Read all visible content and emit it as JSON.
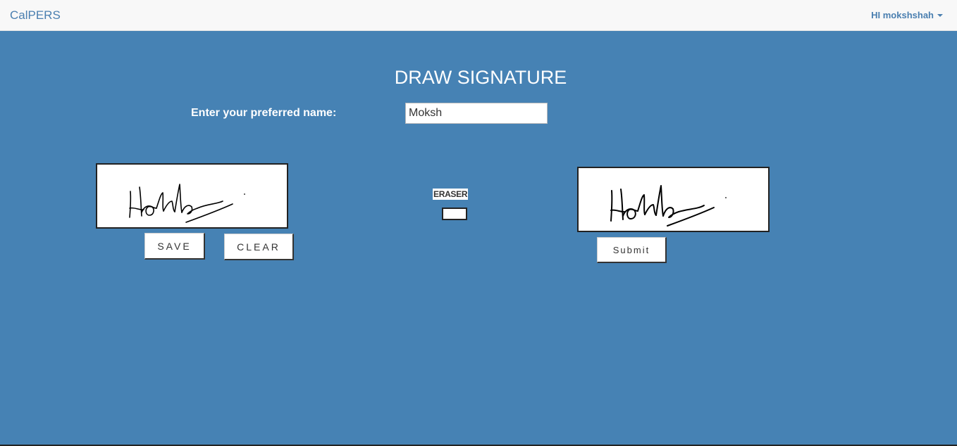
{
  "navbar": {
    "brand": "CalPERS",
    "user_greeting": "HI mokshshah",
    "user_menu_icon": "caret-down-icon"
  },
  "main": {
    "title": "DRAW SIGNATURE",
    "name_label": "Enter your preferred name:",
    "name_value": "Moksh",
    "save_label": "SAVE",
    "clear_label": "CLEAR",
    "eraser_label": "ERASER",
    "submit_label": "Submit"
  },
  "colors": {
    "background": "#4682b4",
    "navbar": "#f8f8f8",
    "brand_text": "#4a7fb0"
  }
}
